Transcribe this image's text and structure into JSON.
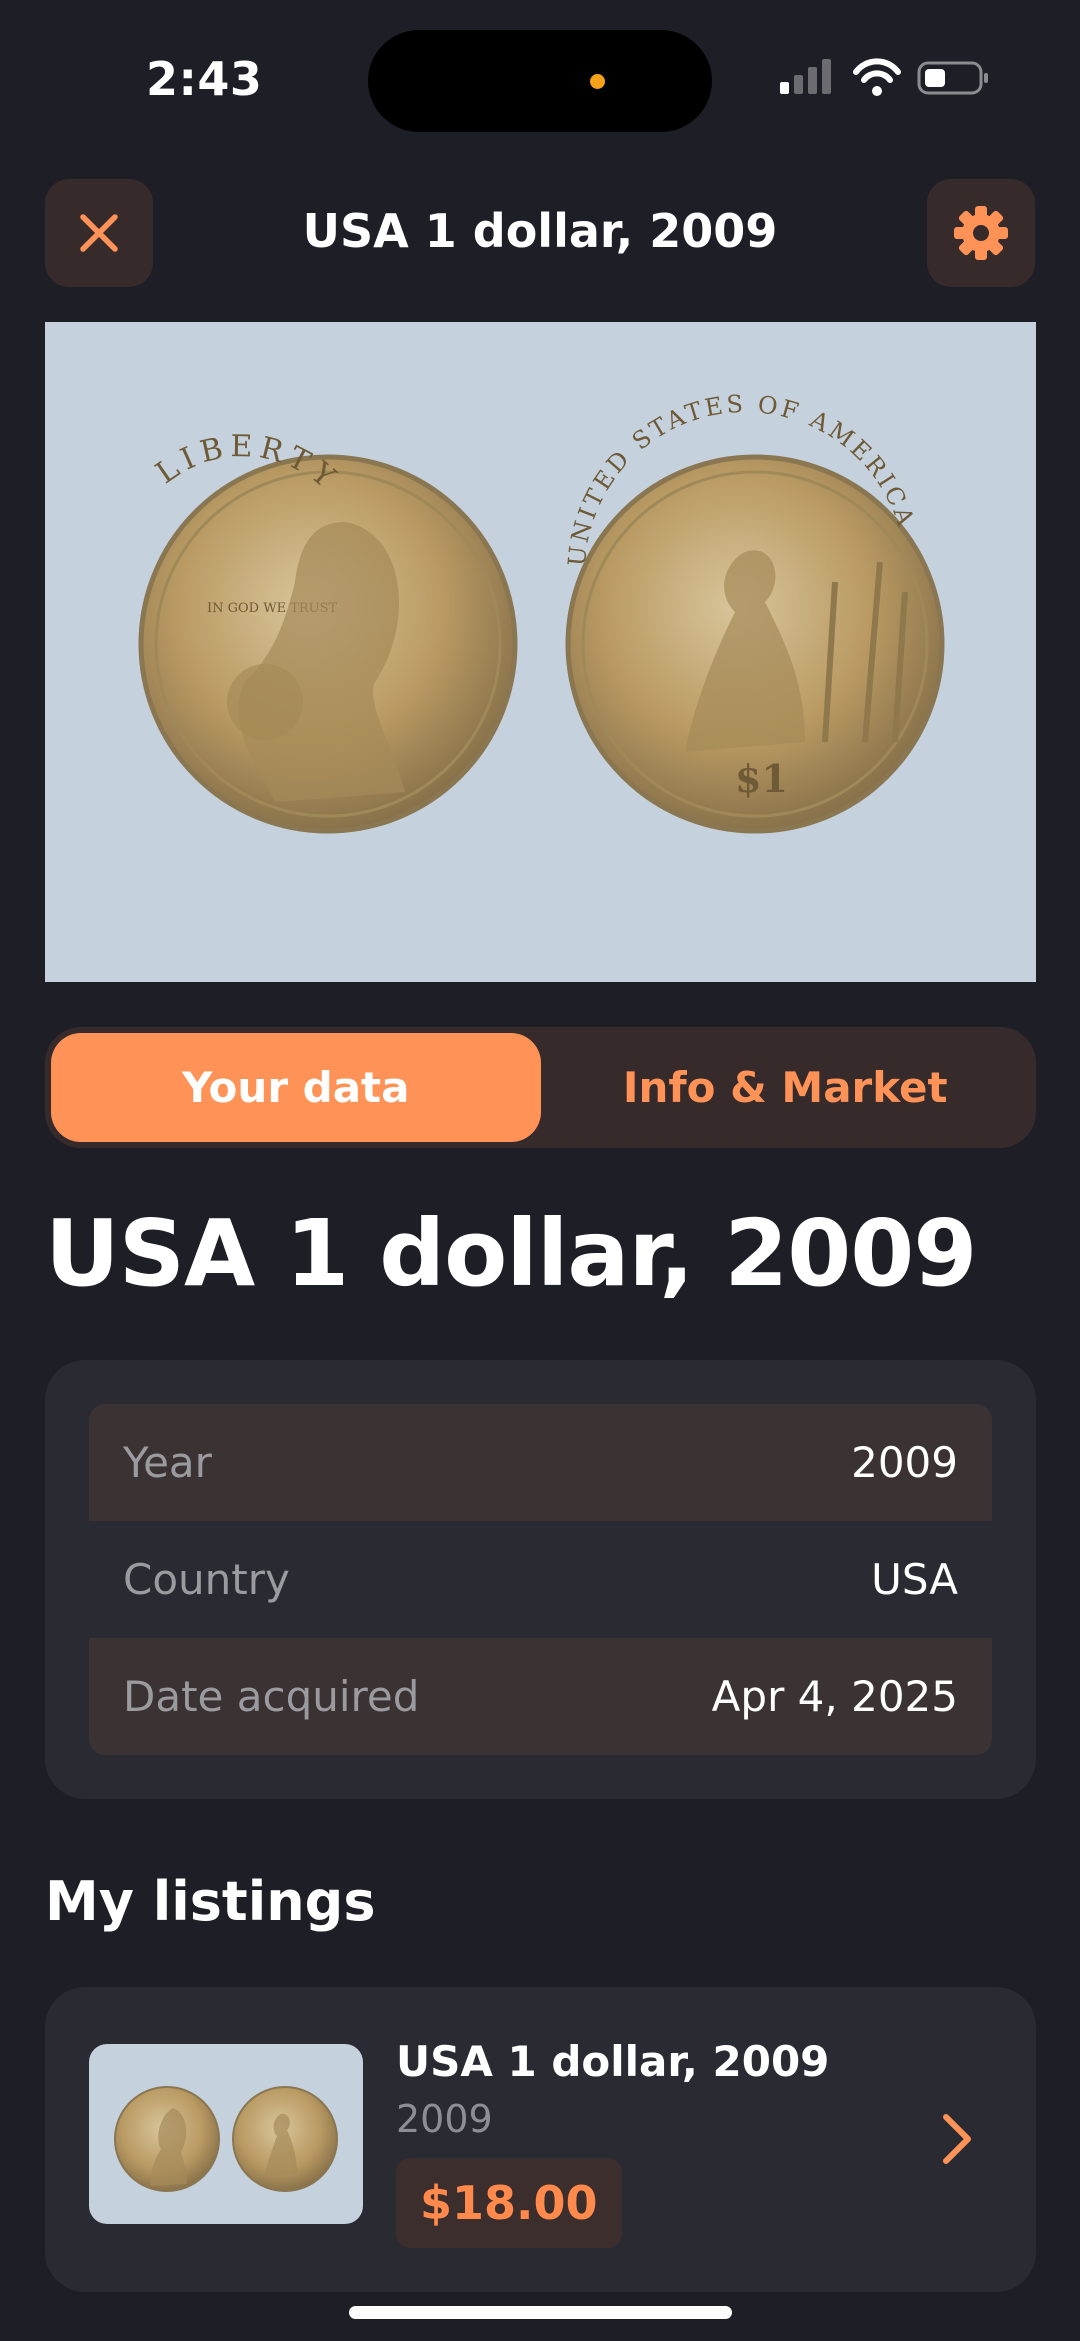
{
  "status_bar": {
    "time": "2:43"
  },
  "header": {
    "title": "USA 1 dollar, 2009",
    "close_icon": "close-icon",
    "settings_icon": "gear-icon",
    "accent_color": "#ff9357"
  },
  "coin_image": {
    "obverse_legend": "LIBERTY",
    "obverse_motto": "IN GOD WE TRUST",
    "reverse_legend": "UNITED STATES OF AMERICA",
    "reverse_denomination": "$1"
  },
  "tabs": [
    {
      "label": "Your data",
      "active": true
    },
    {
      "label": "Info & Market",
      "active": false
    }
  ],
  "coin_title": "USA 1 dollar, 2009",
  "details": [
    {
      "label": "Year",
      "value": "2009"
    },
    {
      "label": "Country",
      "value": "USA"
    },
    {
      "label": "Date acquired",
      "value": "Apr 4, 2025"
    }
  ],
  "listings_section": {
    "title": "My listings",
    "items": [
      {
        "name": "USA 1 dollar, 2009",
        "year": "2009",
        "price": "$18.00"
      }
    ]
  }
}
